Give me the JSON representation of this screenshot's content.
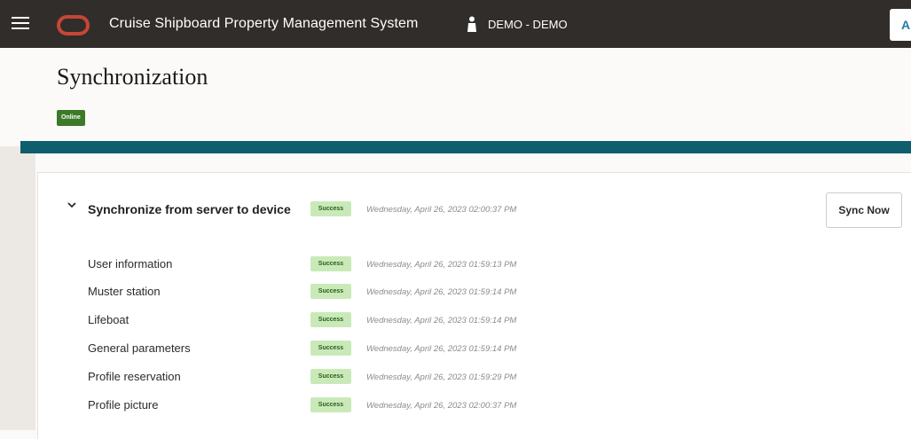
{
  "header": {
    "app_title": "Cruise Shipboard Property Management System",
    "user_label": "DEMO - DEMO",
    "avatar_initial": "A"
  },
  "page": {
    "title": "Synchronization",
    "status_badge": "Online"
  },
  "group": {
    "title": "Synchronize from server to device",
    "status": "Success",
    "timestamp": "Wednesday, April 26, 2023 02:00:37 PM",
    "sync_button": "Sync Now"
  },
  "items": [
    {
      "label": "User information",
      "status": "Success",
      "timestamp": "Wednesday, April 26, 2023 01:59:13 PM"
    },
    {
      "label": "Muster station",
      "status": "Success",
      "timestamp": "Wednesday, April 26, 2023 01:59:14 PM"
    },
    {
      "label": "Lifeboat",
      "status": "Success",
      "timestamp": "Wednesday, April 26, 2023 01:59:14 PM"
    },
    {
      "label": "General parameters",
      "status": "Success",
      "timestamp": "Wednesday, April 26, 2023 01:59:14 PM"
    },
    {
      "label": "Profile reservation",
      "status": "Success",
      "timestamp": "Wednesday, April 26, 2023 01:59:29 PM"
    },
    {
      "label": "Profile picture",
      "status": "Success",
      "timestamp": "Wednesday, April 26, 2023 02:00:37 PM"
    }
  ],
  "colors": {
    "topbar": "#312d2a",
    "oracle_red": "#c74634",
    "online_green": "#3c7a28",
    "success_badge": "#c9eab8",
    "teal_band": "#0f5e6e"
  },
  "icons": [
    "hamburger-menu-icon",
    "oracle-logo-icon",
    "user-icon",
    "chevron-down-icon"
  ]
}
